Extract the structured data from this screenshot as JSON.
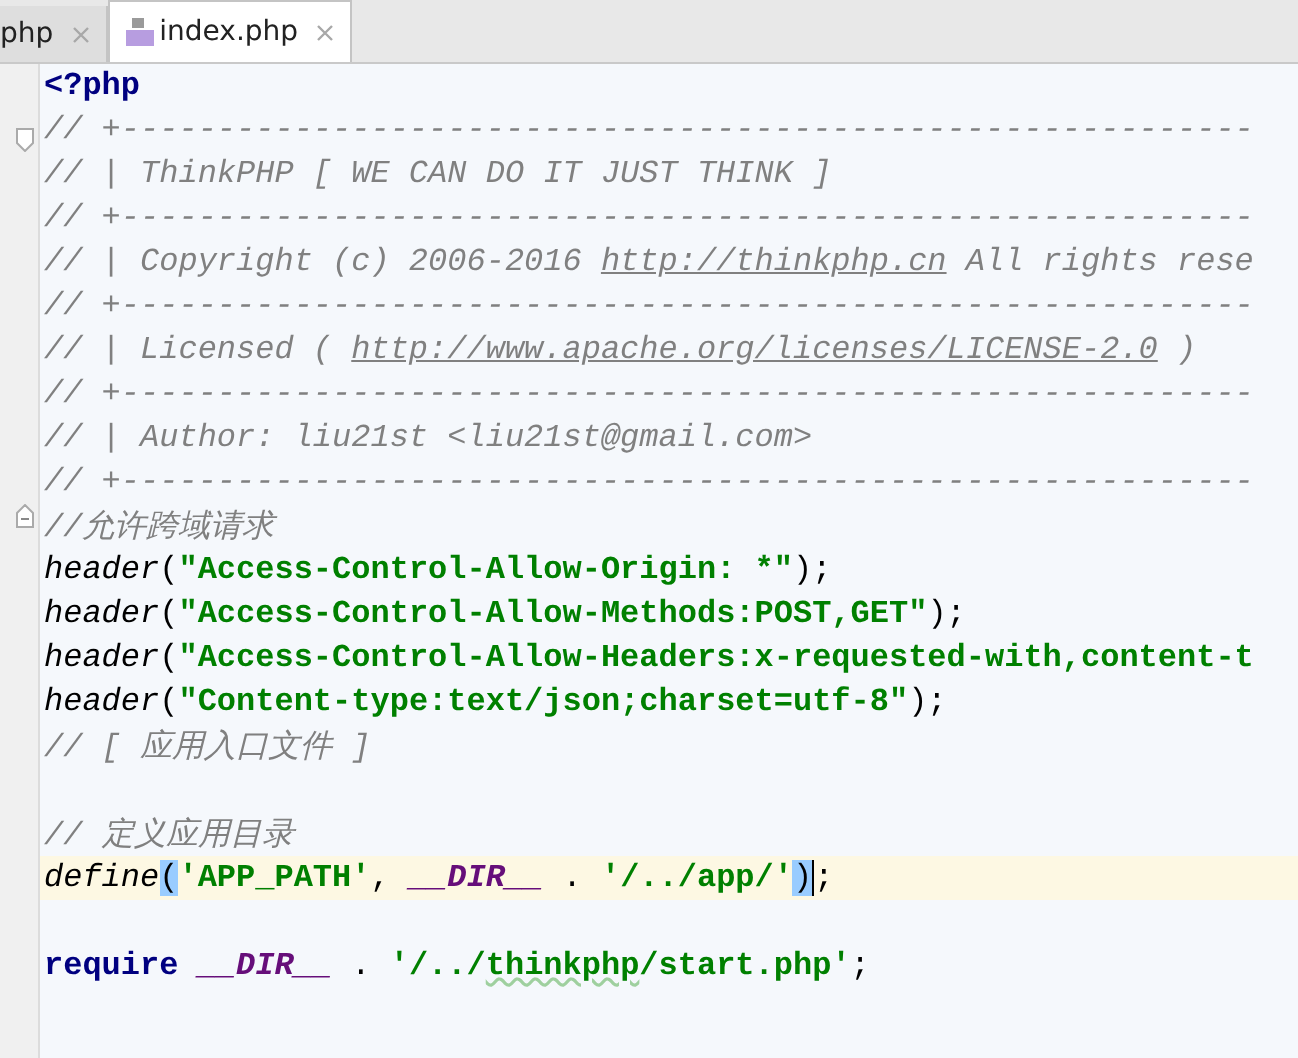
{
  "tabs": [
    {
      "label": "php",
      "selected": false,
      "icon": false
    },
    {
      "label": "index.php",
      "selected": true,
      "icon": true
    }
  ],
  "editor": {
    "lines": [
      {
        "kind": "code",
        "tokens": [
          {
            "kind": "keyword",
            "t": "<?php"
          }
        ]
      },
      {
        "kind": "code",
        "fold_start": true,
        "tokens": [
          {
            "kind": "comment",
            "t": "// +-----------------------------------------------------------"
          }
        ]
      },
      {
        "kind": "code",
        "tokens": [
          {
            "kind": "comment",
            "t": "// | ThinkPHP [ WE CAN DO IT JUST THINK ]"
          }
        ]
      },
      {
        "kind": "code",
        "tokens": [
          {
            "kind": "comment",
            "t": "// +-----------------------------------------------------------"
          }
        ]
      },
      {
        "kind": "code",
        "tokens": [
          {
            "kind": "comment",
            "t": "// | Copyright (c) 2006-2016 "
          },
          {
            "kind": "link",
            "t": "http://thinkphp.cn"
          },
          {
            "kind": "comment",
            "t": " All rights rese"
          }
        ]
      },
      {
        "kind": "code",
        "tokens": [
          {
            "kind": "comment",
            "t": "// +-----------------------------------------------------------"
          }
        ]
      },
      {
        "kind": "code",
        "tokens": [
          {
            "kind": "comment",
            "t": "// | Licensed ( "
          },
          {
            "kind": "link",
            "t": "http://www.apache.org/licenses/LICENSE-2.0"
          },
          {
            "kind": "comment",
            "t": " )"
          }
        ]
      },
      {
        "kind": "code",
        "tokens": [
          {
            "kind": "comment",
            "t": "// +-----------------------------------------------------------"
          }
        ]
      },
      {
        "kind": "code",
        "tokens": [
          {
            "kind": "comment",
            "t": "// | Author: liu21st <liu21st@gmail.com>"
          }
        ]
      },
      {
        "kind": "code",
        "tokens": [
          {
            "kind": "comment",
            "t": "// +-----------------------------------------------------------"
          }
        ]
      },
      {
        "kind": "code",
        "fold_end": true,
        "tokens": [
          {
            "kind": "comment",
            "t": "//允许跨域请求"
          }
        ]
      },
      {
        "kind": "code",
        "tokens": [
          {
            "kind": "func",
            "t": "header"
          },
          {
            "kind": "plain",
            "t": "("
          },
          {
            "kind": "string",
            "t": "\"Access-Control-Allow-Origin: *\""
          },
          {
            "kind": "plain",
            "t": ");"
          }
        ]
      },
      {
        "kind": "code",
        "tokens": [
          {
            "kind": "func",
            "t": "header"
          },
          {
            "kind": "plain",
            "t": "("
          },
          {
            "kind": "string",
            "t": "\"Access-Control-Allow-Methods:POST,GET\""
          },
          {
            "kind": "plain",
            "t": ");"
          }
        ]
      },
      {
        "kind": "code",
        "tokens": [
          {
            "kind": "func",
            "t": "header"
          },
          {
            "kind": "plain",
            "t": "("
          },
          {
            "kind": "string",
            "t": "\"Access-Control-Allow-Headers:x-requested-with,content-t"
          }
        ]
      },
      {
        "kind": "code",
        "tokens": [
          {
            "kind": "func",
            "t": "header"
          },
          {
            "kind": "plain",
            "t": "("
          },
          {
            "kind": "string",
            "t": "\"Content-type:text/json;charset=utf-8\""
          },
          {
            "kind": "plain",
            "t": ");"
          }
        ]
      },
      {
        "kind": "code",
        "tokens": [
          {
            "kind": "comment",
            "t": "// [ 应用入口文件 ]"
          }
        ]
      },
      {
        "kind": "blank"
      },
      {
        "kind": "code",
        "tokens": [
          {
            "kind": "comment",
            "t": "// 定义应用目录"
          }
        ]
      },
      {
        "kind": "code",
        "current": true,
        "tokens": [
          {
            "kind": "func",
            "t": "define"
          },
          {
            "kind": "match",
            "t": "("
          },
          {
            "kind": "string",
            "t": "'APP_PATH'"
          },
          {
            "kind": "plain",
            "t": ", "
          },
          {
            "kind": "constant",
            "t": "__DIR__"
          },
          {
            "kind": "plain",
            "t": " . "
          },
          {
            "kind": "string",
            "t": "'/../app/'"
          },
          {
            "kind": "match",
            "t": ")"
          },
          {
            "kind": "caret"
          },
          {
            "kind": "plain",
            "t": ";"
          }
        ]
      },
      {
        "kind": "blank"
      },
      {
        "kind": "code",
        "tokens": [
          {
            "kind": "keyword",
            "t": "require "
          },
          {
            "kind": "constant",
            "t": "__DIR__"
          },
          {
            "kind": "plain",
            "t": " . "
          },
          {
            "kind": "string",
            "t": "'/../"
          },
          {
            "kind": "typo",
            "t": "thinkphp"
          },
          {
            "kind": "string",
            "t": "/start.php'"
          },
          {
            "kind": "plain",
            "t": ";"
          }
        ]
      }
    ]
  }
}
